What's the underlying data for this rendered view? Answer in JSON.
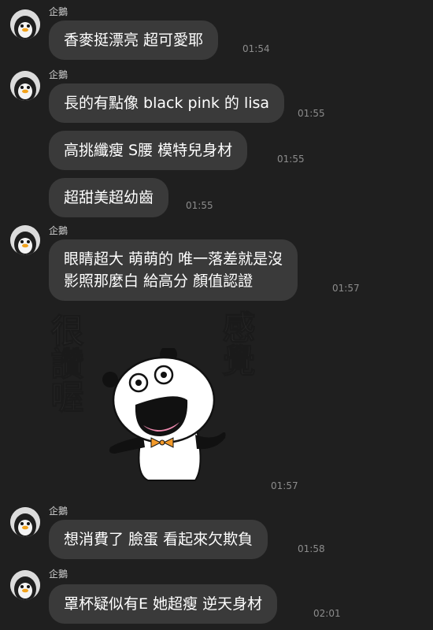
{
  "contact": {
    "name": "企鵝",
    "avatar_icon": "penguin-icon"
  },
  "messages": [
    {
      "sender": "企鵝",
      "lines": [
        "香麥挺漂亮 超可愛耶"
      ],
      "time": "01:54"
    },
    {
      "sender": "企鵝",
      "lines": [
        "長的有點像 black pink 的 lisa"
      ],
      "time": "01:55"
    },
    {
      "lines": [
        "高挑纖瘦 S腰 模特兒身材"
      ],
      "time": "01:55"
    },
    {
      "lines": [
        "超甜美超幼齒"
      ],
      "time": "01:55"
    },
    {
      "sender": "企鵝",
      "lines": [
        "眼睛超大 萌萌的 唯一落差就是沒",
        "影照那麼白 給高分 顏值認證"
      ],
      "time": "01:57"
    },
    {
      "sticker": {
        "icon": "panda-sticker-icon",
        "left_text": "很讚喔",
        "right_text": "感覺"
      },
      "time": "01:57"
    },
    {
      "sender": "企鵝",
      "lines": [
        "想消費了 臉蛋 看起來欠欺負"
      ],
      "time": "01:58"
    },
    {
      "sender": "企鵝",
      "lines": [
        "罩杯疑似有E 她超瘦 逆天身材"
      ],
      "time": "02:01"
    }
  ],
  "colors": {
    "background": "#1f1f1f",
    "bubble": "#3a3a3a",
    "text": "#ffffff",
    "timestamp": "#8c8c8c"
  }
}
